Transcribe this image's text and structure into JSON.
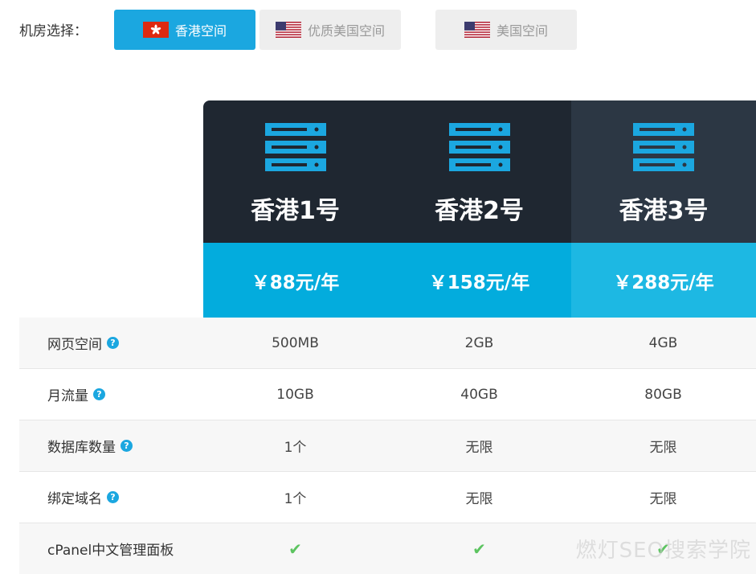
{
  "region": {
    "label": "机房选择：",
    "tabs": [
      {
        "label": "香港空间",
        "flag": "hk-flag-icon",
        "active": true
      },
      {
        "label": "优质美国空间",
        "flag": "us-flag-icon",
        "active": false
      },
      {
        "label": "美国空间",
        "flag": "us-flag-icon",
        "active": false
      }
    ]
  },
  "plans": [
    {
      "name": "香港1号",
      "price": "￥88元/年",
      "icon": "server-icon"
    },
    {
      "name": "香港2号",
      "price": "￥158元/年",
      "icon": "server-icon"
    },
    {
      "name": "香港3号",
      "price": "￥288元/年",
      "icon": "server-icon"
    }
  ],
  "features": [
    {
      "label": "网页空间",
      "help": "?",
      "values": [
        "500MB",
        "2GB",
        "4GB"
      ]
    },
    {
      "label": "月流量",
      "help": "?",
      "values": [
        "10GB",
        "40GB",
        "80GB"
      ]
    },
    {
      "label": "数据库数量",
      "help": "?",
      "values": [
        "1个",
        "无限",
        "无限"
      ]
    },
    {
      "label": "绑定域名",
      "help": "?",
      "values": [
        "1个",
        "无限",
        "无限"
      ]
    },
    {
      "label": "cPanel中文管理面板",
      "values": [
        "✔",
        "✔",
        "✔"
      ]
    }
  ],
  "watermark": "燃灯SEO搜索学院",
  "colors": {
    "accent": "#1ba7e0",
    "header_dark": "#1f2731",
    "header_alt": "#2c3744",
    "price": "#03acdd",
    "price_alt": "#1db8e3",
    "check": "#5cc460"
  }
}
